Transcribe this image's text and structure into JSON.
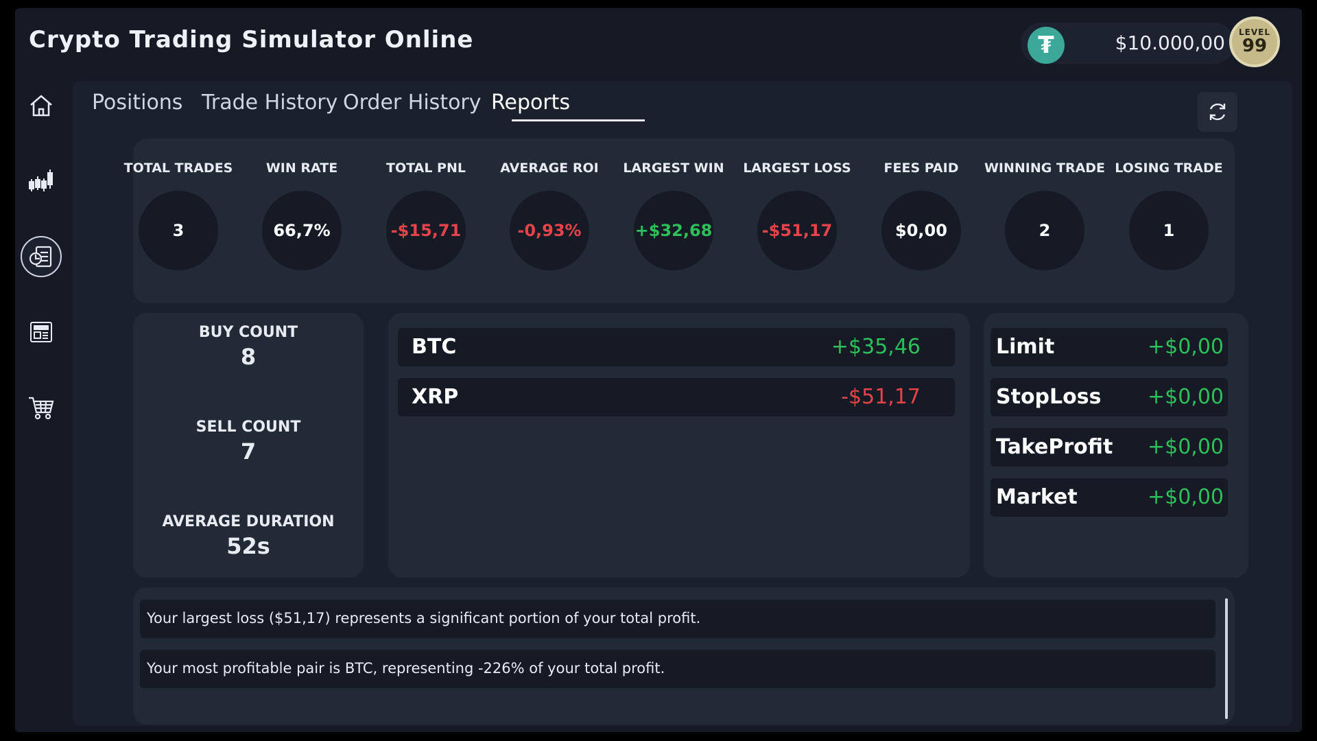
{
  "app": {
    "title": "Crypto Trading Simulator Online"
  },
  "header": {
    "balance": "$10.000,00",
    "coin_icon": "tether-coin-icon",
    "level_label": "LEVEL",
    "level_value": "99"
  },
  "sidebar": {
    "items": [
      {
        "icon": "home-icon"
      },
      {
        "icon": "candlestick-chart-icon"
      },
      {
        "icon": "report-icon",
        "active": true
      },
      {
        "icon": "news-icon"
      },
      {
        "icon": "shopping-cart-icon"
      }
    ]
  },
  "tabs": [
    {
      "label": "Positions"
    },
    {
      "label": "Trade History"
    },
    {
      "label": "Order History"
    },
    {
      "label": "Reports",
      "active": true
    }
  ],
  "stats": [
    {
      "label": "TOTAL TRADES",
      "value": "3",
      "tone": "neutral"
    },
    {
      "label": "WIN RATE",
      "value": "66,7%",
      "tone": "neutral"
    },
    {
      "label": "TOTAL PNL",
      "value": "-$15,71",
      "tone": "neg"
    },
    {
      "label": "AVERAGE ROI",
      "value": "-0,93%",
      "tone": "neg"
    },
    {
      "label": "LARGEST WIN",
      "value": "+$32,68",
      "tone": "pos"
    },
    {
      "label": "LARGEST LOSS",
      "value": "-$51,17",
      "tone": "neg"
    },
    {
      "label": "FEES PAID",
      "value": "$0,00",
      "tone": "neutral"
    },
    {
      "label": "WINNING TRADE",
      "value": "2",
      "tone": "neutral"
    },
    {
      "label": "LOSING TRADE",
      "value": "1",
      "tone": "neutral"
    }
  ],
  "counts": {
    "buy_label": "BUY COUNT",
    "buy_value": "8",
    "sell_label": "SELL COUNT",
    "sell_value": "7",
    "duration_label": "AVERAGE DURATION",
    "duration_value": "52s"
  },
  "pairs": [
    {
      "name": "BTC",
      "value": "+$35,46",
      "tone": "pos"
    },
    {
      "name": "XRP",
      "value": "-$51,17",
      "tone": "neg"
    }
  ],
  "order_types": [
    {
      "name": "Limit",
      "value": "+$0,00"
    },
    {
      "name": "StopLoss",
      "value": "+$0,00"
    },
    {
      "name": "TakeProfit",
      "value": "+$0,00"
    },
    {
      "name": "Market",
      "value": "+$0,00"
    }
  ],
  "insights": [
    "Your largest loss ($51,17) represents a significant portion of your total profit.",
    "Your most profitable pair is BTC, representing -226% of your total profit."
  ],
  "colors": {
    "positive": "#2dbf5a",
    "negative": "#e5434a",
    "accent": "#3ba89a"
  }
}
